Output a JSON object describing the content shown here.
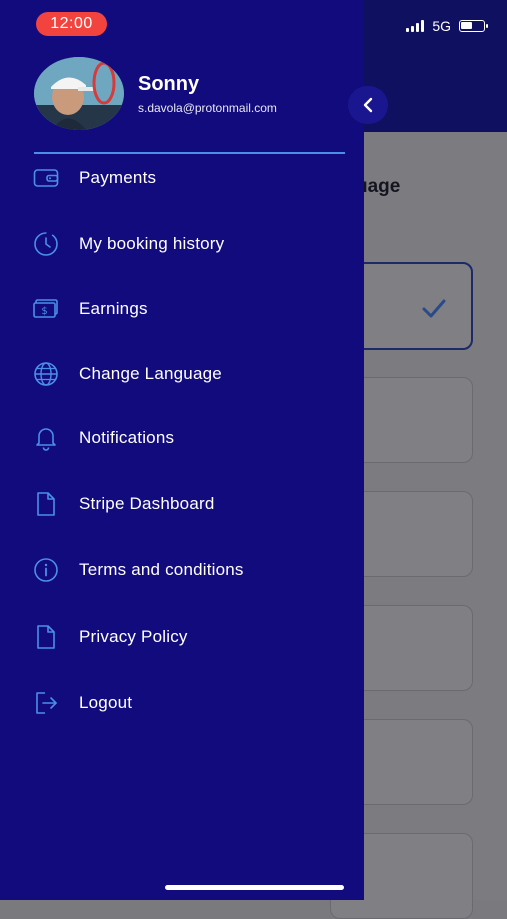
{
  "status_bar": {
    "time": "12:00",
    "network": "5G",
    "battery_level": 0.5
  },
  "background_page": {
    "title_fragment": "uage"
  },
  "drawer": {
    "user": {
      "name": "Sonny",
      "email": "s.davola@protonmail.com"
    },
    "menu_items": [
      {
        "label": "Payments",
        "icon": "wallet-icon"
      },
      {
        "label": "My booking history",
        "icon": "clock-icon"
      },
      {
        "label": "Earnings",
        "icon": "cash-icon"
      },
      {
        "label": "Change Language",
        "icon": "globe-icon"
      },
      {
        "label": "Notifications",
        "icon": "bell-icon"
      },
      {
        "label": "Stripe Dashboard",
        "icon": "document-icon"
      },
      {
        "label": "Terms and conditions",
        "icon": "info-icon"
      },
      {
        "label": "Privacy Policy",
        "icon": "document-icon"
      },
      {
        "label": "Logout",
        "icon": "logout-icon"
      }
    ]
  },
  "colors": {
    "drawer_bg": "#120b7d",
    "accent": "#4b8fe8",
    "time_pill": "#f2433f"
  }
}
